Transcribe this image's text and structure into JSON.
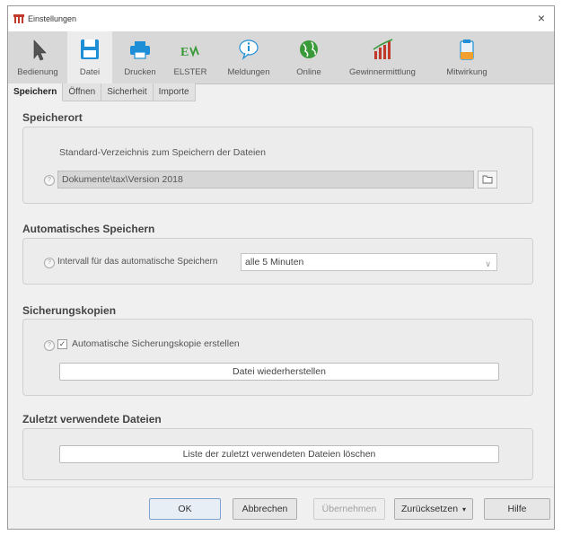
{
  "window": {
    "title": "Einstellungen",
    "close_symbol": "×"
  },
  "toolbar": {
    "items": [
      {
        "label": "Bedienung",
        "icon": "cursor-arrow-icon"
      },
      {
        "label": "Datei",
        "icon": "floppy-disk-icon",
        "active": true
      },
      {
        "label": "Drucken",
        "icon": "printer-icon"
      },
      {
        "label": "ELSTER",
        "icon": "elster-icon"
      },
      {
        "label": "Meldungen",
        "icon": "info-bubble-icon"
      },
      {
        "label": "Online",
        "icon": "globe-icon"
      },
      {
        "label": "Gewinnermittlung",
        "icon": "bar-chart-icon"
      },
      {
        "label": "Mitwirkung",
        "icon": "clipboard-icon"
      }
    ]
  },
  "subtabs": [
    {
      "label": "Speichern",
      "active": true
    },
    {
      "label": "Öffnen"
    },
    {
      "label": "Sicherheit"
    },
    {
      "label": "Importe"
    }
  ],
  "speicherort": {
    "title": "Speicherort",
    "description": "Standard-Verzeichnis zum Speichern der Dateien",
    "path_value": "Dokumente\\tax\\Version 2018",
    "help": "?"
  },
  "autosave": {
    "title": "Automatisches Speichern",
    "label": "Intervall für das automatische Speichern",
    "selected": "alle 5 Minuten",
    "help": "?"
  },
  "backup": {
    "title": "Sicherungskopien",
    "checkbox_label": "Automatische Sicherungskopie erstellen",
    "checked": true,
    "checkmark": "✓",
    "restore_button": "Datei wiederherstellen",
    "help": "?"
  },
  "recent": {
    "title": "Zuletzt verwendete Dateien",
    "clear_button": "Liste der zuletzt verwendeten Dateien löschen"
  },
  "footer": {
    "ok": "OK",
    "cancel": "Abbrechen",
    "apply": "Übernehmen",
    "reset": "Zurücksetzen",
    "reset_arrow": "▾",
    "help": "Hilfe"
  },
  "colors": {
    "accent_blue": "#1e8fd6",
    "toolbar_bg": "#d8d8d8",
    "elster_green": "#3a9a3a"
  }
}
